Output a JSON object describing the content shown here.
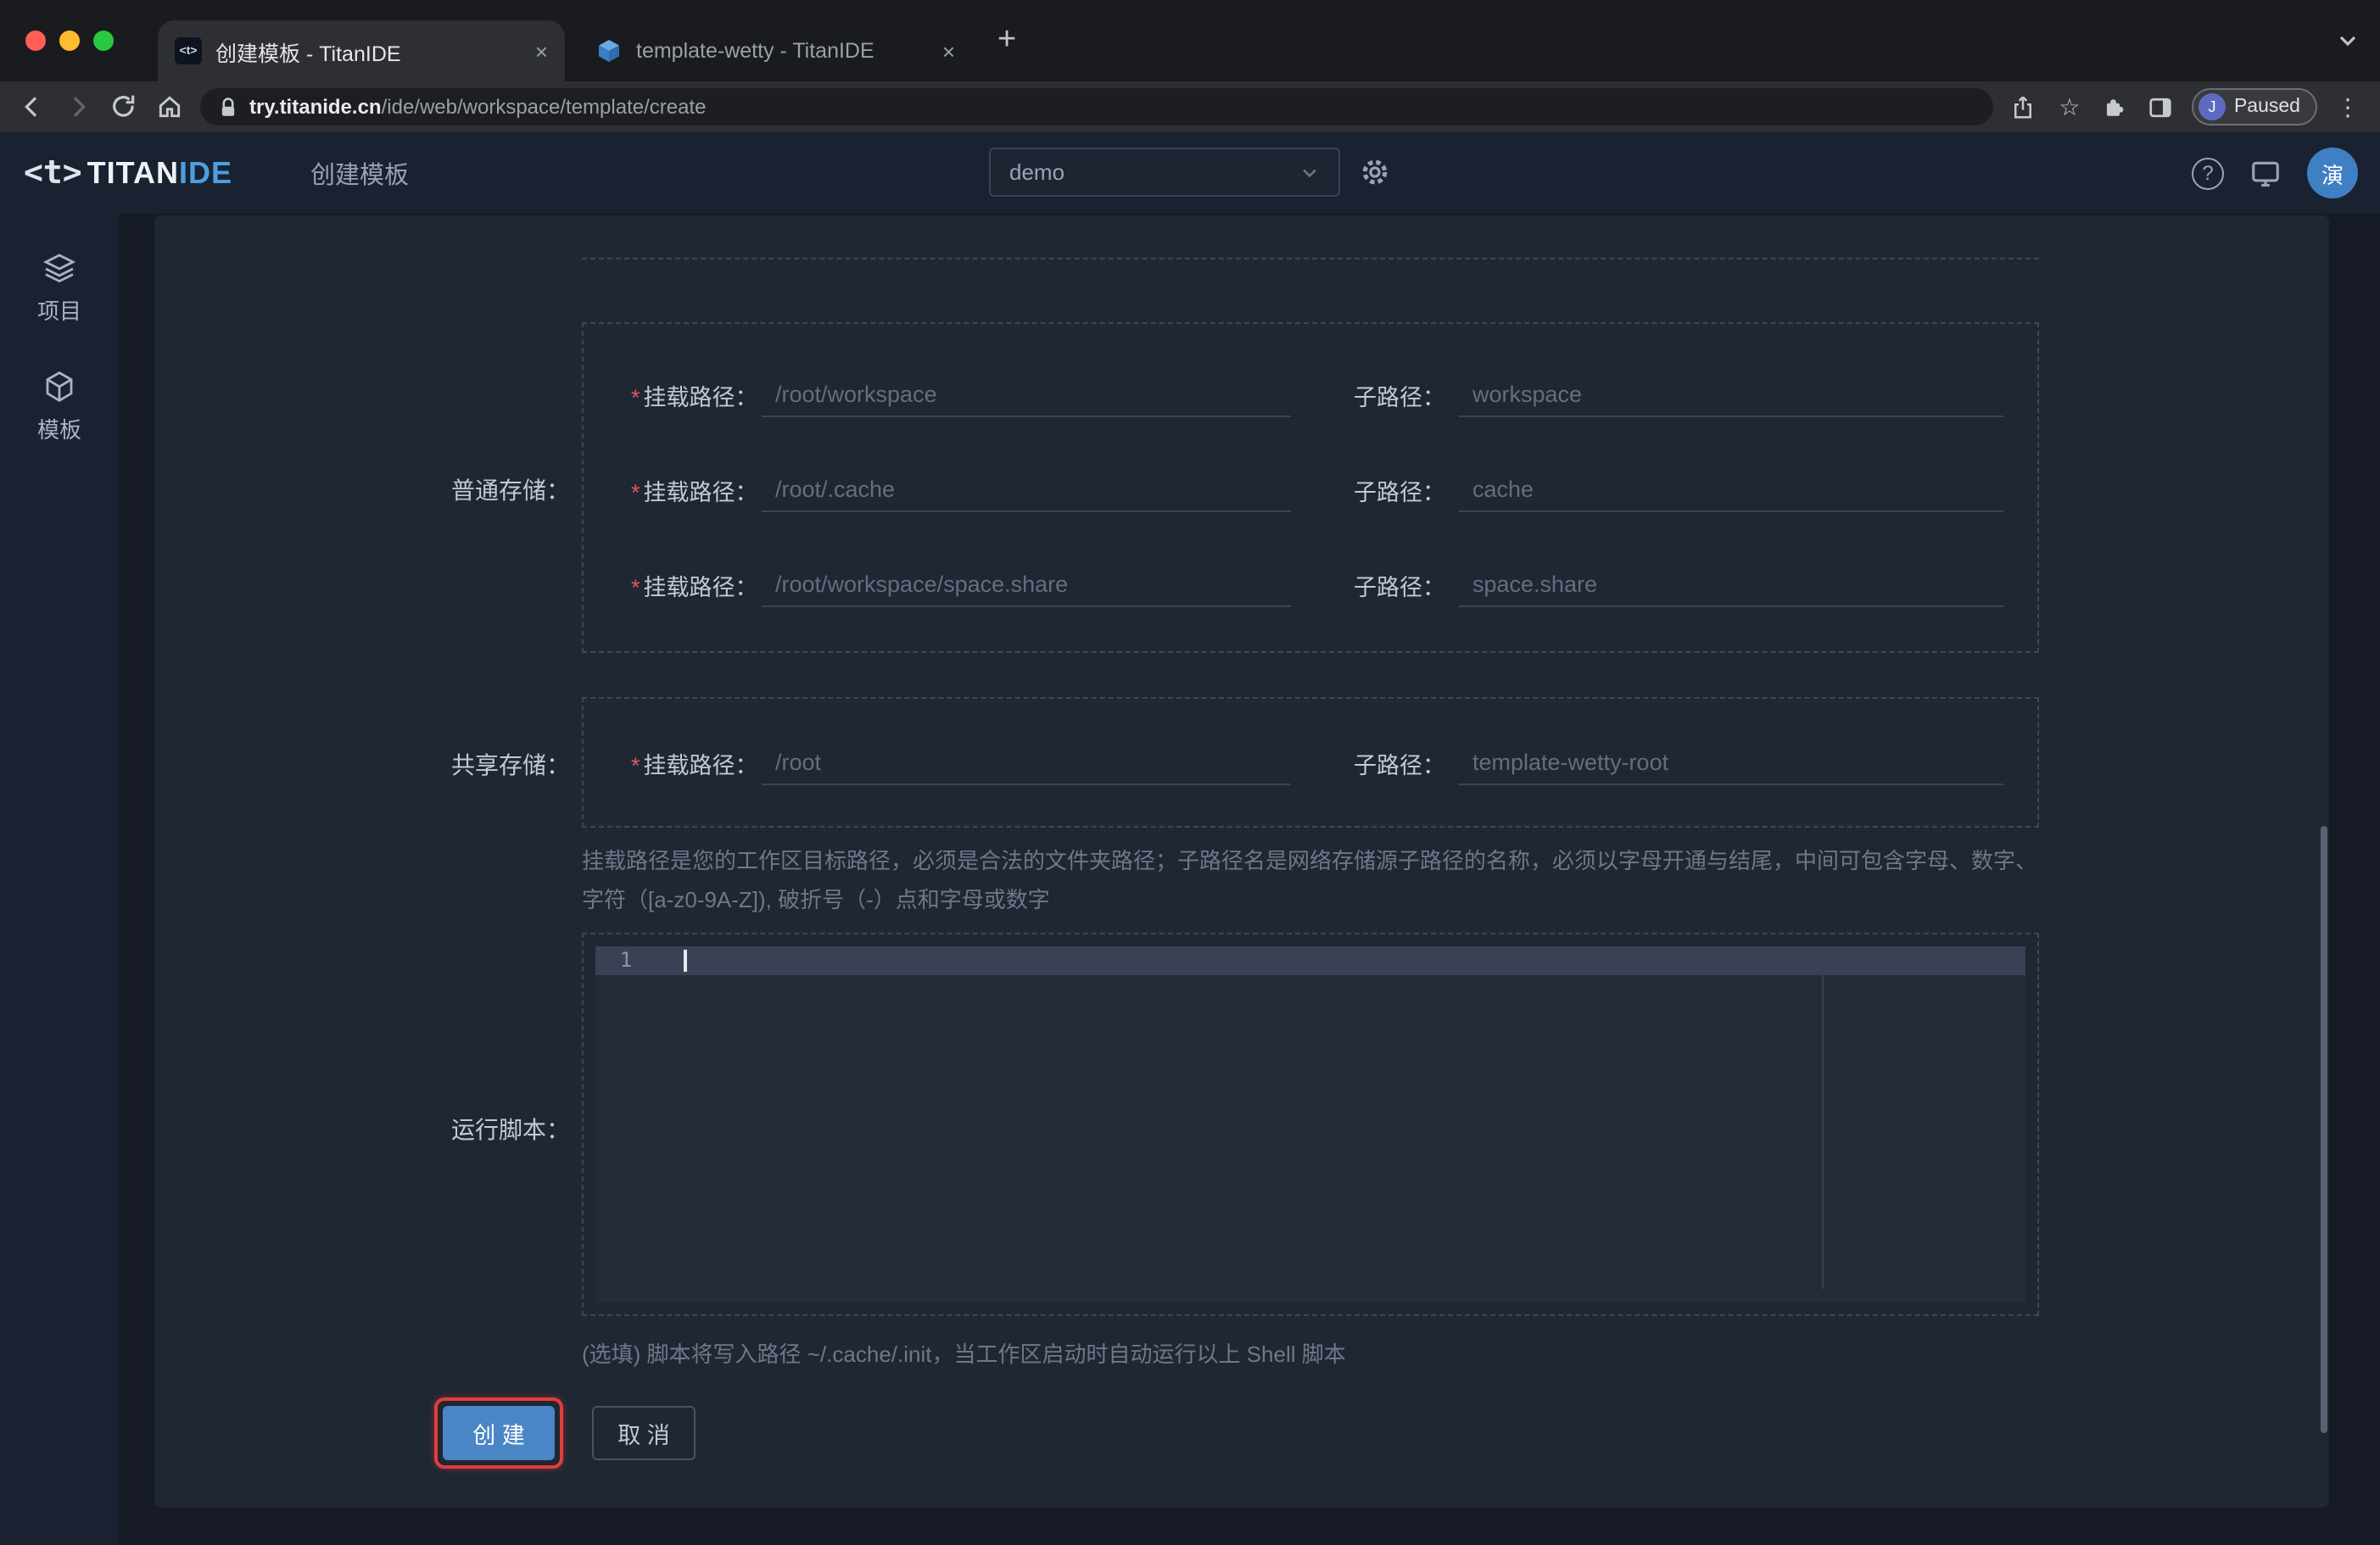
{
  "browser": {
    "tabs": [
      {
        "title": "创建模板 - TitanIDE"
      },
      {
        "title": "template-wetty - TitanIDE"
      }
    ],
    "url": {
      "host": "try.titanide.cn",
      "path": "/ide/web/workspace/template/create"
    },
    "profile": {
      "initial": "J",
      "status": "Paused"
    }
  },
  "icons": {
    "close": "×",
    "new_tab": "+",
    "menu": "⋮",
    "star": "☆",
    "help": "?"
  },
  "header": {
    "logo": {
      "bracket": "<t>",
      "titan": "TITAN",
      "ide": "IDE"
    },
    "page_title": "创建模板",
    "workspace": {
      "selected": "demo"
    },
    "avatar": "演"
  },
  "sidebar": {
    "items": [
      {
        "label": "项目"
      },
      {
        "label": "模板"
      }
    ]
  },
  "form": {
    "sections": {
      "normal_storage": "普通存储：",
      "shared_storage": "共享存储：",
      "run_script": "运行脚本："
    },
    "labels": {
      "mount": "挂载路径：",
      "sub": "子路径：",
      "required_mark": "*"
    },
    "normal_rows": [
      {
        "mount": "/root/workspace",
        "sub": "workspace"
      },
      {
        "mount": "/root/.cache",
        "sub": "cache"
      },
      {
        "mount": "/root/workspace/space.share",
        "sub": "space.share"
      }
    ],
    "shared_rows": [
      {
        "mount": "/root",
        "sub": "template-wetty-root"
      }
    ],
    "path_help": "挂载路径是您的工作区目标路径，必须是合法的文件夹路径；子路径名是网络存储源子路径的名称，必须以字母开通与结尾，中间可包含字母、数字、字符（[a-z0-9A-Z]), 破折号（-）点和字母或数字",
    "editor": {
      "line_number": "1"
    },
    "script_help": "(选填) 脚本将写入路径 ~/.cache/.init，当工作区启动时自动运行以上 Shell 脚本",
    "buttons": {
      "create": "创 建",
      "cancel": "取 消"
    }
  },
  "colors": {
    "accent_blue": "#4d9fdf",
    "button_blue": "#4a86c5",
    "highlight_red": "#e23c3c",
    "required_red": "#e25563"
  }
}
